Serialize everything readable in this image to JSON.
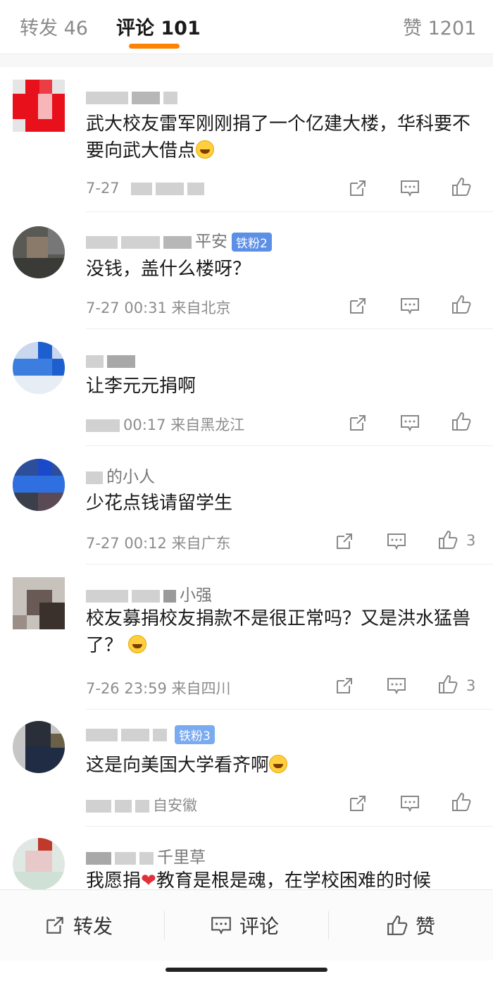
{
  "tabs": {
    "repost": "转发 46",
    "comments": "评论 101",
    "likes": "赞 1201"
  },
  "colors": {
    "accent": "#ff8200",
    "badge": "#5c8fe6",
    "heart": "#e0303a"
  },
  "icons": [
    "share-icon",
    "comment-icon",
    "like-icon"
  ],
  "comments": [
    {
      "name": "",
      "text": "武大校友雷军刚刚捐了一个亿建大楼，华科要不要向武大借点",
      "meta": "7-27",
      "likes": ""
    },
    {
      "name": "平安",
      "badge": "铁粉2",
      "text": "没钱，盖什么楼呀？",
      "meta": "7-27 00:31  来自北京",
      "likes": ""
    },
    {
      "name": "",
      "text": "让李元元捐啊",
      "meta": "00:17  来自黑龙江",
      "likes": ""
    },
    {
      "name": "的小人",
      "text": "少花点钱请留学生",
      "meta": "7-27 00:12  来自广东",
      "likes": "3"
    },
    {
      "name": "小强",
      "text": "校友募捐校友捐款不是很正常吗？又是洪水猛兽了？",
      "meta": "7-26 23:59  来自四川",
      "likes": "3"
    },
    {
      "name": "",
      "badge": "铁粉3",
      "text": "这是向美国大学看齐啊",
      "meta": "自安徽",
      "likes": ""
    },
    {
      "name": "千里草",
      "text": "我愿捐",
      "text_tail": "教育是根是魂，在学校困难的时候",
      "meta": "",
      "likes": ""
    }
  ],
  "bottom_bar": {
    "repost": "转发",
    "comment": "评论",
    "like": "赞"
  }
}
